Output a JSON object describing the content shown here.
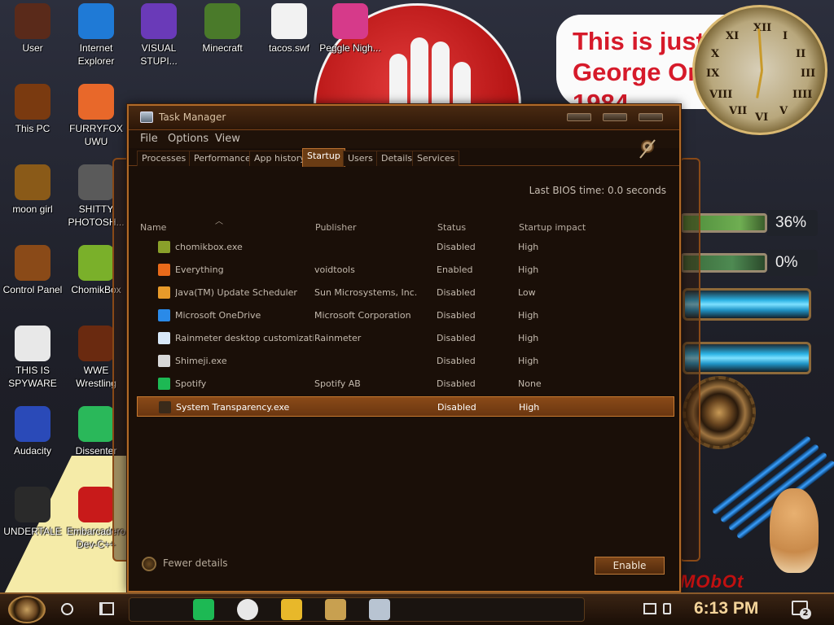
{
  "desktop": {
    "meme_text": [
      "This is just like",
      "George Orwell's",
      "1984"
    ],
    "clock_numerals": [
      "XII",
      "I",
      "II",
      "III",
      "IIII",
      "V",
      "VI",
      "VII",
      "VIII",
      "IX",
      "X",
      "XI"
    ],
    "gauges": [
      "36%",
      "0%"
    ],
    "wallpaper_text": "MObOt",
    "icons": [
      {
        "label": "User",
        "icon": "user-folder-icon",
        "color": "#5a2a1a"
      },
      {
        "label": "Internet Explorer",
        "icon": "edge-icon",
        "color": "#1f7ad6"
      },
      {
        "label": "VISUAL STUPI...",
        "icon": "visual-studio-icon",
        "color": "#6a3ab8"
      },
      {
        "label": "Minecraft",
        "icon": "minecraft-icon",
        "color": "#4a7a2a"
      },
      {
        "label": "tacos.swf",
        "icon": "flash-file-icon",
        "color": "#f2f2f2"
      },
      {
        "label": "Peggle Nigh...",
        "icon": "peggle-icon",
        "color": "#d63a8a"
      },
      {
        "label": "This PC",
        "icon": "this-pc-icon",
        "color": "#7a3a10"
      },
      {
        "label": "FURRYFOX UWU",
        "icon": "firefox-icon",
        "color": "#e8682a"
      },
      {
        "label": "moon girl",
        "icon": "folder-icon",
        "color": "#8a5a18"
      },
      {
        "label": "SHITTY PHOTOSH...",
        "icon": "gimp-icon",
        "color": "#5a5a5a"
      },
      {
        "label": "Control Panel",
        "icon": "control-panel-icon",
        "color": "#8a4a18"
      },
      {
        "label": "ChomikBox",
        "icon": "chomikbox-icon",
        "color": "#7ab02a"
      },
      {
        "label": "THIS IS SPYWARE",
        "icon": "chrome-icon",
        "color": "#e8e8e8"
      },
      {
        "label": "WWE Wrestling",
        "icon": "wwe-icon",
        "color": "#6a2a10"
      },
      {
        "label": "Audacity",
        "icon": "audacity-icon",
        "color": "#2a4ab8"
      },
      {
        "label": "Dissenter",
        "icon": "dissenter-icon",
        "color": "#2ab85a"
      },
      {
        "label": "UNDERTALE",
        "icon": "unity-icon",
        "color": "#2a2a2a"
      },
      {
        "label": "Embarcadero Dev-C++",
        "icon": "devcpp-icon",
        "color": "#c81a1a"
      }
    ]
  },
  "task_manager": {
    "title": "Task Manager",
    "menu": [
      "File",
      "Options",
      "View"
    ],
    "tabs": [
      "Processes",
      "Performance",
      "App history",
      "Startup",
      "Users",
      "Details",
      "Services"
    ],
    "active_tab": "Startup",
    "bios_time": "Last BIOS time:  0.0 seconds",
    "columns": {
      "name": "Name",
      "publisher": "Publisher",
      "status": "Status",
      "impact": "Startup impact"
    },
    "rows": [
      {
        "name": "chomikbox.exe",
        "publisher": "",
        "status": "Disabled",
        "impact": "High",
        "icon": "chomikbox-icon",
        "icon_color": "#8aa02a"
      },
      {
        "name": "Everything",
        "publisher": "voidtools",
        "status": "Enabled",
        "impact": "High",
        "icon": "search-icon",
        "icon_color": "#e86a1a"
      },
      {
        "name": "Java(TM) Update Scheduler",
        "publisher": "Sun Microsystems, Inc.",
        "status": "Disabled",
        "impact": "Low",
        "icon": "java-icon",
        "icon_color": "#e89a2a"
      },
      {
        "name": "Microsoft OneDrive",
        "publisher": "Microsoft Corporation",
        "status": "Disabled",
        "impact": "High",
        "icon": "onedrive-icon",
        "icon_color": "#2a8ae8"
      },
      {
        "name": "Rainmeter desktop customizatio...",
        "publisher": "Rainmeter",
        "status": "Disabled",
        "impact": "High",
        "icon": "rainmeter-icon",
        "icon_color": "#d8e8f8"
      },
      {
        "name": "Shimeji.exe",
        "publisher": "",
        "status": "Disabled",
        "impact": "High",
        "icon": "shimeji-icon",
        "icon_color": "#d8d8d8"
      },
      {
        "name": "Spotify",
        "publisher": "Spotify AB",
        "status": "Disabled",
        "impact": "None",
        "icon": "spotify-icon",
        "icon_color": "#1db954"
      },
      {
        "name": "System Transparency.exe",
        "publisher": "",
        "status": "Disabled",
        "impact": "High",
        "icon": "transparency-icon",
        "icon_color": "#3a2a1a"
      }
    ],
    "selected_row": 7,
    "fewer_details": "Fewer details",
    "enable_button": "Enable"
  },
  "taskbar": {
    "time": "6:13 PM",
    "notification_count": "2",
    "pinned": [
      {
        "name": "spotify-icon",
        "color": "#1db954"
      },
      {
        "name": "chrome-icon",
        "color": "#e8e8e8"
      },
      {
        "name": "file-explorer-icon",
        "color": "#e8b82a"
      },
      {
        "name": "chomikbox-icon",
        "color": "#c8a050"
      },
      {
        "name": "task-manager-icon",
        "color": "#b8c4d2"
      }
    ]
  }
}
